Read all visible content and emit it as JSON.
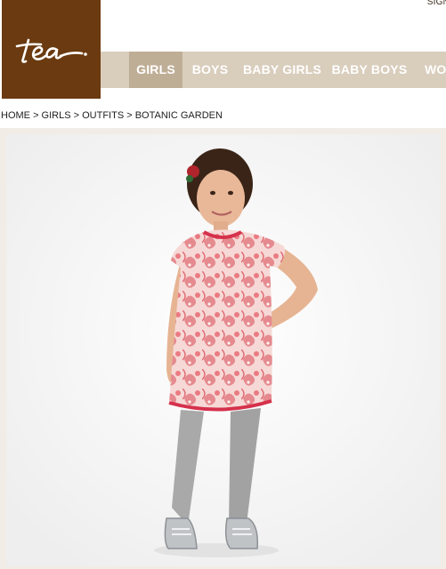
{
  "header": {
    "logo_text": "tea.",
    "signin_label": "SIGN"
  },
  "nav": {
    "tabs": [
      {
        "label": "GIRLS",
        "active": true
      },
      {
        "label": "BOYS",
        "active": false
      },
      {
        "label": "BABY GIRLS",
        "active": false
      },
      {
        "label": "BABY BOYS",
        "active": false
      },
      {
        "label": "WO",
        "active": false
      }
    ]
  },
  "breadcrumb": {
    "items": [
      "HOME",
      "GIRLS",
      "OUTFITS",
      "BOTANIC GARDEN"
    ],
    "separator": ">"
  },
  "colors": {
    "brand_brown": "#6b3a10",
    "nav_bg": "#d9cdbc",
    "nav_active": "#bfae96",
    "dress_pink": "#e86a7a"
  },
  "product_image": {
    "icon": "model-photo"
  }
}
